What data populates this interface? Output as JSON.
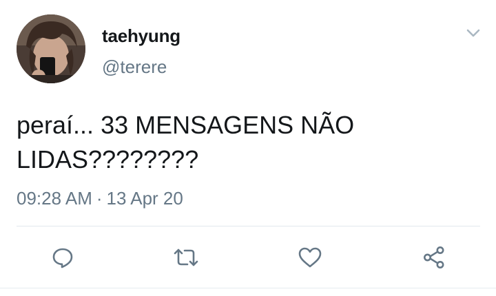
{
  "user": {
    "display_name": "taehyung",
    "handle": "@terere"
  },
  "tweet": {
    "text": "peraí... 33 MENSAGENS NÃO\nLIDAS????????",
    "time": "09:28 AM",
    "separator": "·",
    "date": "13 Apr 20"
  },
  "icons": {
    "menu": "chevron-down-icon",
    "reply": "reply-icon",
    "retweet": "retweet-icon",
    "like": "heart-icon",
    "share": "share-icon"
  },
  "colors": {
    "text_primary": "#14171a",
    "text_secondary": "#657786",
    "icon": "#657786",
    "divider": "#e1e8ed"
  }
}
